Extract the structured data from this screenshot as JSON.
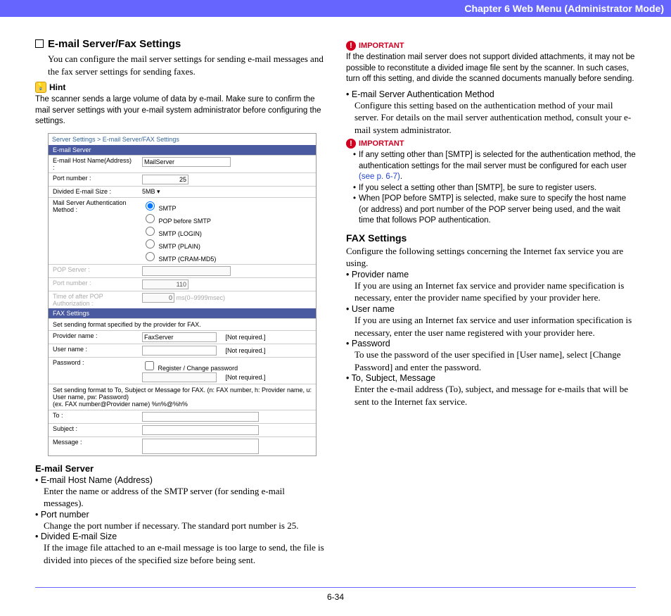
{
  "header": "Chapter 6   Web Menu (Administrator Mode)",
  "page_number": "6-34",
  "left": {
    "title": "E-mail Server/Fax Settings",
    "intro": "You can configure the mail server settings for sending e-mail messages and the fax server settings for sending faxes.",
    "hint_label": "Hint",
    "hint_text": "The scanner sends a large volume of data by e-mail. Make sure to confirm the mail server settings with your e-mail system administrator before configuring the settings.",
    "shot": {
      "crumb": "Server Settings > E-mail Server/FAX Settings",
      "bar1": "E-mail Server",
      "r_host_l": "E-mail Host Name(Address) :",
      "r_host_v": "MailServer",
      "r_port_l": "Port number :",
      "r_port_v": "25",
      "r_div_l": "Divided E-mail Size :",
      "r_div_v": "5MB   ▾",
      "r_auth_l": "Mail Server Authentication Method :",
      "auth_opt1": "SMTP",
      "auth_opt2": "POP before SMTP",
      "auth_opt3": "SMTP (LOGIN)",
      "auth_opt4": "SMTP (PLAIN)",
      "auth_opt5": "SMTP (CRAM-MD5)",
      "r_pop_l": "POP Server :",
      "r_pport_l": "Port number :",
      "r_pport_v": "110",
      "r_time_l": "Time of after POP Authorization :",
      "r_time_v": "ms(0–9999msec)",
      "bar2": "FAX Settings",
      "fax_note1": "Set sending format specified by the provider for FAX.",
      "r_prov_l": "Provider name :",
      "r_prov_v": "FaxServer",
      "not_req": "[Not required.]",
      "r_user_l": "User name :",
      "r_pass_l": "Password :",
      "r_pass_chk": "Register / Change password",
      "fax_note2": "Set sending format to To, Subject or Message for FAX. (n: FAX number, h: Provider name, u: User name, pw: Password)\n(ex. FAX number@Provider name) %n%@%h%",
      "r_to_l": "To :",
      "r_sub_l": "Subject :",
      "r_msg_l": "Message :"
    },
    "emailserver_h": "E-mail Server",
    "em1_l": "E-mail Host Name (Address)",
    "em1_d": "Enter the name or address of the SMTP server (for sending e-mail messages).",
    "em2_l": "Port number",
    "em2_d": "Change the port number if necessary. The standard port number is 25.",
    "em3_l": "Divided E-mail Size",
    "em3_d": "If the image file attached to an e-mail message is too large to send, the file is divided into pieces of the specified size before being sent."
  },
  "right": {
    "imp1_label": "IMPORTANT",
    "imp1_text": "If the destination mail server does not support divided attachments, it may not be possible to reconstitute a divided image file sent by the scanner. In such cases, turn off this setting, and divide the scanned documents manually before sending.",
    "auth_l": "E-mail Server Authentication Method",
    "auth_d": "Configure this setting based on the authentication method of your mail server. For details on the mail server authentication method, consult your e-mail system administrator.",
    "imp2_label": "IMPORTANT",
    "imp2_a": "If any setting other than [SMTP] is selected for the authentication method, the authentication settings for the mail server must be configured for each user ",
    "imp2_a_link": "(see p. 6-7)",
    "imp2_a_end": ".",
    "imp2_b": "If you select a setting other than [SMTP], be sure to register users.",
    "imp2_c": "When [POP before SMTP] is selected, make sure to specify the host name (or address) and port number of the POP server being used, and the wait time that follows POP authentication.",
    "fax_h": "FAX Settings",
    "fax_intro": "Configure the following settings concerning the Internet fax service you are using.",
    "f1_l": "Provider name",
    "f1_d": "If you are using an Internet fax service and provider name specification is necessary, enter the provider name specified by your provider here.",
    "f2_l": "User name",
    "f2_d": "If you are using an Internet fax service and user information specification is necessary, enter the user name registered with your provider here.",
    "f3_l": "Password",
    "f3_d": "To use the password of the user specified in [User name], select [Change Password] and enter the password.",
    "f4_l": "To, Subject, Message",
    "f4_d": "Enter the e-mail address (To), subject, and message for e-mails that will be sent to the Internet fax service."
  }
}
